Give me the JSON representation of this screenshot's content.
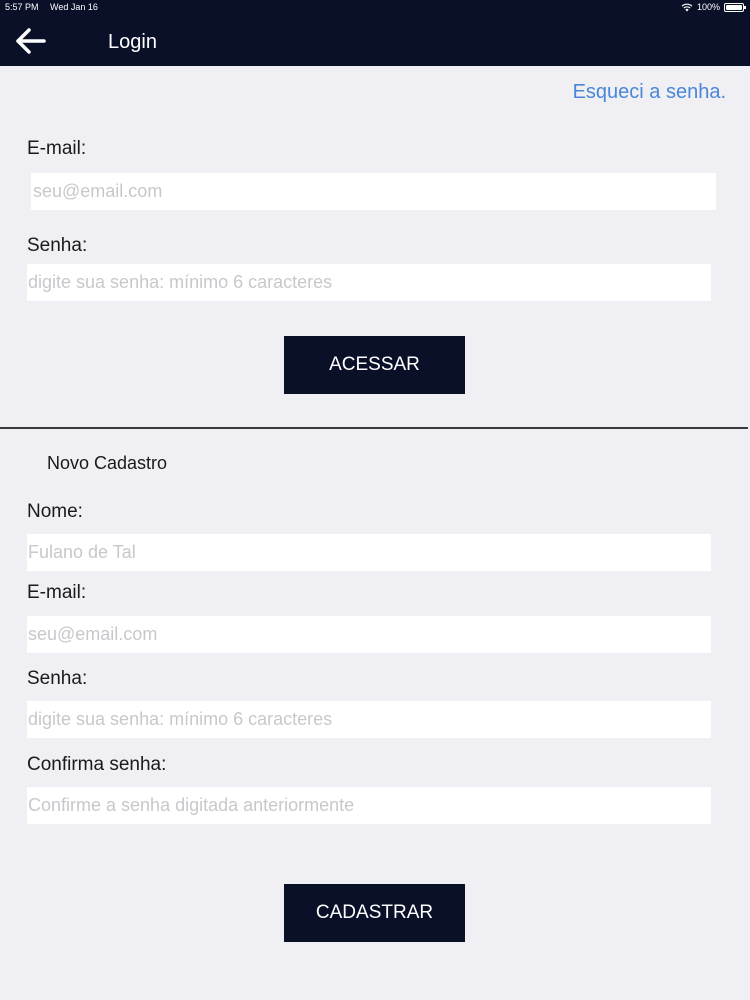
{
  "status_bar": {
    "time": "5:57 PM",
    "date": "Wed Jan 16",
    "battery": "100%"
  },
  "nav": {
    "title": "Login",
    "back_icon": "arrow-left-icon"
  },
  "login": {
    "forgot_link": "Esqueci a senha.",
    "email_label": "E-mail:",
    "email_placeholder": "seu@email.com",
    "password_label": "Senha:",
    "password_placeholder": "digite sua senha: mínimo 6 caracteres",
    "submit_label": "ACESSAR"
  },
  "register": {
    "section_title": "Novo Cadastro",
    "name_label": "Nome:",
    "name_placeholder": "Fulano de Tal",
    "email_label": "E-mail:",
    "email_placeholder": "seu@email.com",
    "password_label": "Senha:",
    "password_placeholder": "digite sua senha: mínimo 6 caracteres",
    "confirm_label": "Confirma senha:",
    "confirm_placeholder": "Confirme a senha digitada anteriormente",
    "submit_label": "CADASTRAR"
  },
  "colors": {
    "nav_background": "#0b1029",
    "page_background": "#efeff4",
    "link": "#4a86d8"
  }
}
